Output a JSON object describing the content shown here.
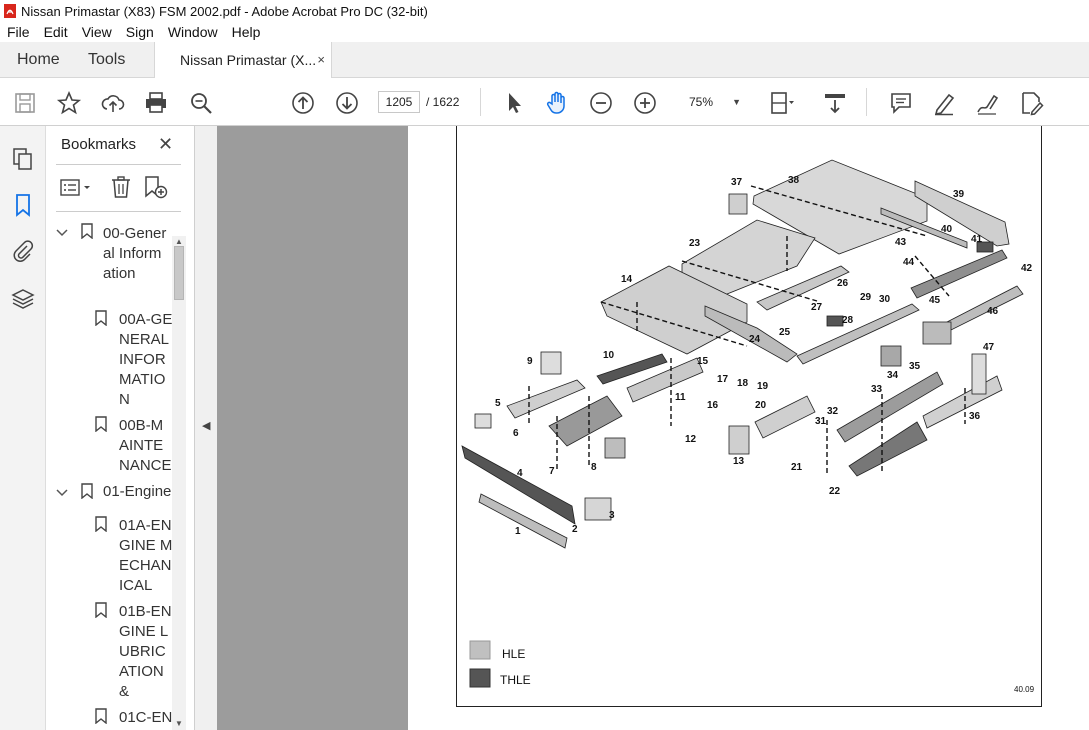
{
  "window": {
    "title": "Nissan Primastar (X83) FSM 2002.pdf - Adobe Acrobat Pro DC (32-bit)"
  },
  "menu": [
    "File",
    "Edit",
    "View",
    "Sign",
    "Window",
    "Help"
  ],
  "tabs": {
    "home": "Home",
    "tools": "Tools",
    "document": "Nissan Primastar (X...",
    "close_glyph": "×"
  },
  "toolbar": {
    "current_page": "1205",
    "total_pages": "/ 1622",
    "zoom": "75%",
    "icons": [
      "save-icon",
      "star-icon",
      "upload-icon",
      "print-icon",
      "search-zoom-icon",
      "page-up-icon",
      "page-down-icon",
      "select-arrow-icon",
      "hand-icon",
      "zoom-out-icon",
      "zoom-in-icon",
      "fit-page-icon",
      "scroll-mode-icon",
      "comment-icon",
      "highlight-pen-icon",
      "sign-icon",
      "edit-pdf-icon"
    ]
  },
  "sidebar": {
    "title": "Bookmarks",
    "close_glyph": "✕",
    "items": [
      {
        "label": "00-General Information",
        "level": 0,
        "expanded": true
      },
      {
        "label": "00A-GENERAL INFORMATION",
        "level": 1
      },
      {
        "label": "00B-MAINTENANCE",
        "level": 1
      },
      {
        "label": "01-Engine",
        "level": 0,
        "expanded": true
      },
      {
        "label": "01A-ENGINE MECHANICAL",
        "level": 1
      },
      {
        "label": "01B-ENGINE LUBRICATION &",
        "level": 1
      },
      {
        "label": "01C-EN",
        "level": 1
      }
    ]
  },
  "figure": {
    "part_numbers": [
      "1",
      "2",
      "3",
      "4",
      "5",
      "6",
      "7",
      "8",
      "9",
      "10",
      "11",
      "12",
      "13",
      "14",
      "15",
      "16",
      "17",
      "18",
      "19",
      "20",
      "21",
      "22",
      "23",
      "24",
      "25",
      "26",
      "27",
      "28",
      "29",
      "30",
      "31",
      "32",
      "33",
      "34",
      "35",
      "36",
      "37",
      "38",
      "39",
      "40",
      "41",
      "42",
      "43",
      "44",
      "45",
      "46",
      "47"
    ],
    "legend": [
      {
        "label": "HLE",
        "color": "#c0c0c0"
      },
      {
        "label": "THLE",
        "color": "#555555"
      }
    ],
    "code": "40.09"
  }
}
